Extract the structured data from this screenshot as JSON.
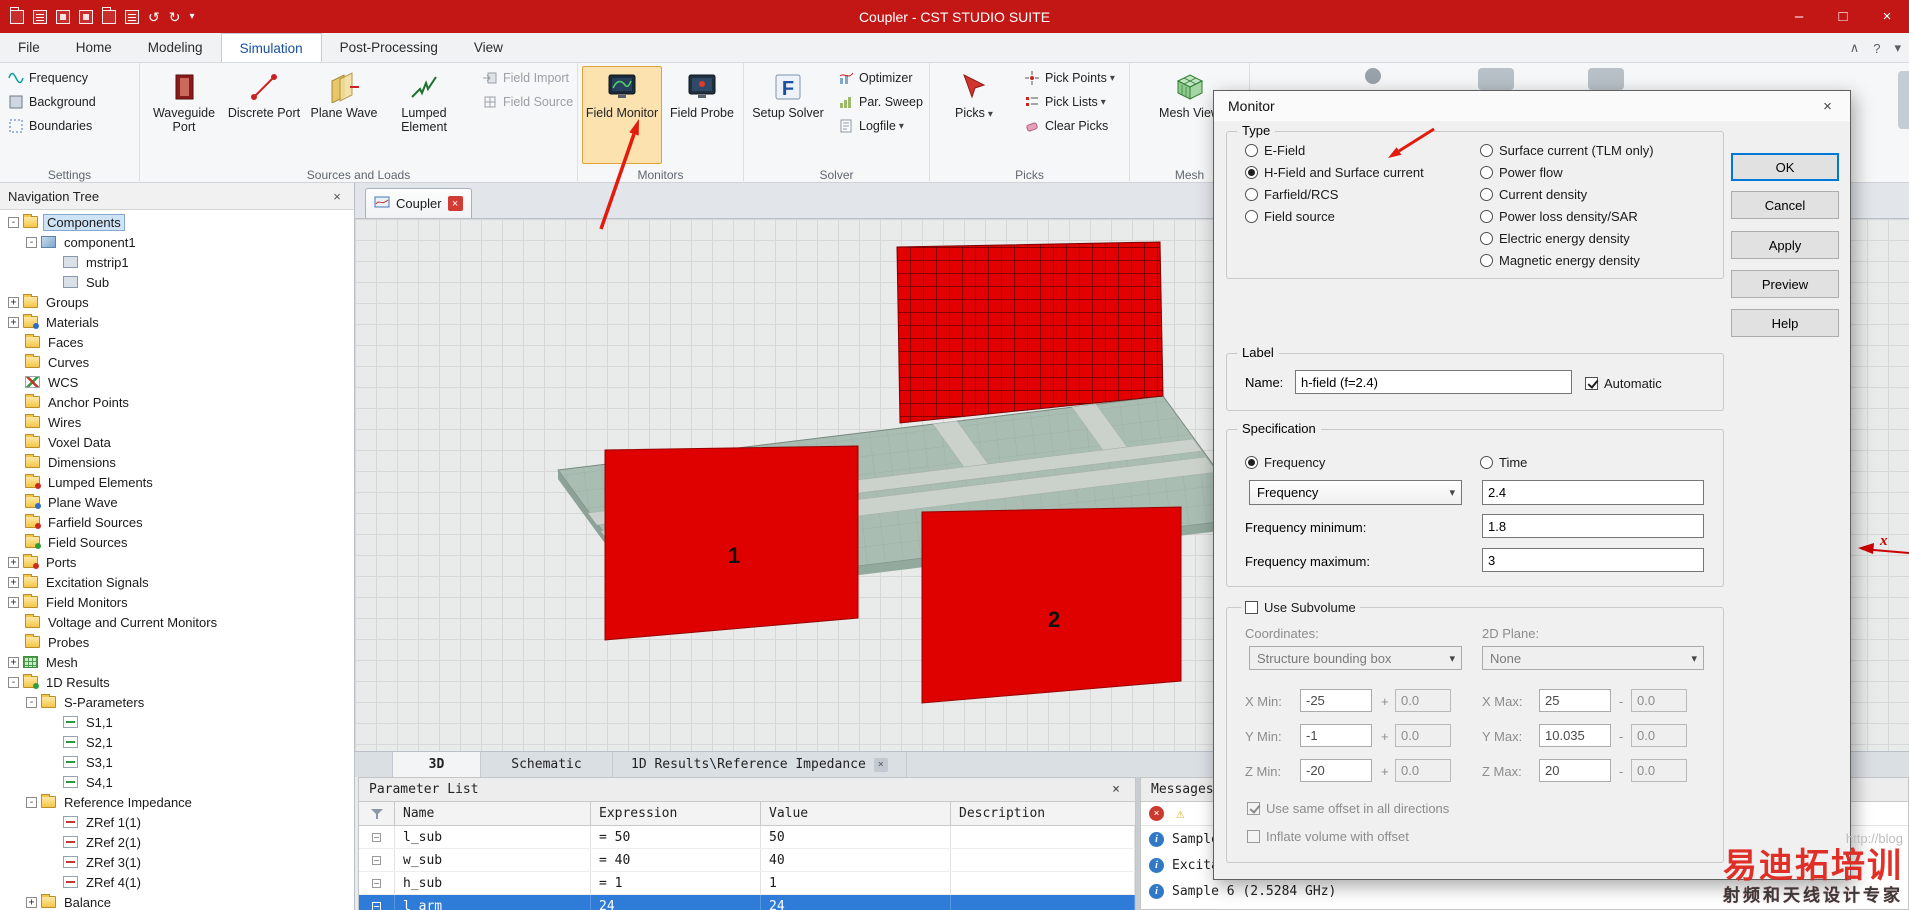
{
  "titlebar": {
    "title": "Coupler - CST STUDIO SUITE"
  },
  "menubar": {
    "tabs": [
      "File",
      "Home",
      "Modeling",
      "Simulation",
      "Post-Processing",
      "View"
    ]
  },
  "ribbon": {
    "settings": {
      "label": "Settings",
      "frequency": "Frequency",
      "background": "Background",
      "boundaries": "Boundaries"
    },
    "sources": {
      "label": "Sources and Loads",
      "waveguide": "Waveguide Port",
      "discrete": "Discrete Port",
      "plane": "Plane Wave",
      "lumped": "Lumped Element",
      "field_import": "Field Import",
      "field_source": "Field Source"
    },
    "monitors": {
      "label": "Monitors",
      "field_monitor": "Field Monitor",
      "field_probe": "Field Probe"
    },
    "solver": {
      "label": "Solver",
      "setup": "Setup Solver",
      "optimizer": "Optimizer",
      "par_sweep": "Par. Sweep",
      "logfile": "Logfile"
    },
    "picks": {
      "label": "Picks",
      "picks": "Picks",
      "pick_points": "Pick Points",
      "pick_lists": "Pick Lists",
      "clear_picks": "Clear Picks"
    },
    "mesh": {
      "label": "Mesh",
      "mesh_view": "Mesh View"
    }
  },
  "nav": {
    "title": "Navigation Tree",
    "items": [
      "Components",
      "component1",
      "mstrip1",
      "Sub",
      "Groups",
      "Materials",
      "Faces",
      "Curves",
      "WCS",
      "Anchor Points",
      "Wires",
      "Voxel Data",
      "Dimensions",
      "Lumped Elements",
      "Plane Wave",
      "Farfield Sources",
      "Field Sources",
      "Ports",
      "Excitation Signals",
      "Field Monitors",
      "Voltage and Current Monitors",
      "Probes",
      "Mesh",
      "1D Results",
      "S-Parameters",
      "S1,1",
      "S2,1",
      "S3,1",
      "S4,1",
      "Reference Impedance",
      "ZRef 1(1)",
      "ZRef 2(1)",
      "ZRef 3(1)",
      "ZRef 4(1)",
      "Balance"
    ]
  },
  "viewport": {
    "doc_tab": "Coupler",
    "view_tabs": [
      "3D",
      "Schematic",
      "1D Results\\Reference Impedance"
    ],
    "active_view_tab": "3D",
    "port_label_1": "1",
    "port_label_2": "2",
    "axis_x": "x"
  },
  "parameters": {
    "title": "Parameter List",
    "columns": [
      "Name",
      "Expression",
      "Value",
      "Description"
    ],
    "rows": [
      {
        "name": "l_sub",
        "expr": "= 50",
        "value": "50",
        "desc": ""
      },
      {
        "name": "w_sub",
        "expr": "= 40",
        "value": "40",
        "desc": ""
      },
      {
        "name": "h_sub",
        "expr": "= 1",
        "value": "1",
        "desc": ""
      },
      {
        "name": "l_arm",
        "expr": "24",
        "value": "24",
        "desc": ""
      }
    ]
  },
  "messages": {
    "title": "Messages",
    "items": [
      "Sample",
      "Excita",
      "Sample 6 (2.5284 GHz)"
    ]
  },
  "dialog": {
    "title": "Monitor",
    "type": {
      "label": "Type",
      "col1": [
        "E-Field",
        "H-Field and Surface current",
        "Farfield/RCS",
        "Field source"
      ],
      "col2": [
        "Surface current (TLM only)",
        "Power flow",
        "Current density",
        "Power loss density/SAR",
        "Electric energy density",
        "Magnetic energy density"
      ],
      "selected": "H-Field and Surface current"
    },
    "buttons": [
      "OK",
      "Cancel",
      "Apply",
      "Preview",
      "Help"
    ],
    "label_group": {
      "label": "Label",
      "name_label": "Name:",
      "name_value": "h-field (f=2.4)",
      "automatic": "Automatic"
    },
    "spec": {
      "label": "Specification",
      "frequency": "Frequency",
      "time": "Time",
      "combo": "Frequency",
      "value": "2.4",
      "min_label": "Frequency minimum:",
      "min": "1.8",
      "max_label": "Frequency maximum:",
      "max": "3"
    },
    "sub": {
      "use": "Use Subvolume",
      "coords_label": "Coordinates:",
      "coords": "Structure bounding box",
      "plane_label": "2D Plane:",
      "plane": "None",
      "xmin_l": "X Min:",
      "xmin": "-25",
      "xmin_o": "0.0",
      "xmax_l": "X Max:",
      "xmax": "25",
      "xmax_o": "0.0",
      "ymin_l": "Y Min:",
      "ymin": "-1",
      "ymin_o": "0.0",
      "ymax_l": "Y Max:",
      "ymax": "10.035",
      "ymax_o": "0.0",
      "zmin_l": "Z Min:",
      "zmin": "-20",
      "zmin_o": "0.0",
      "zmax_l": "Z Max:",
      "zmax": "20",
      "zmax_o": "0.0",
      "plus": "+",
      "minus": "-",
      "same_offset": "Use same offset in all directions",
      "inflate": "Inflate volume with offset"
    }
  },
  "watermark": {
    "url": "http://blog",
    "brand": "易迪拓培训",
    "tagline": "射频和天线设计专家"
  },
  "icons": {
    "close": "×",
    "minimize": "–",
    "maximize": "□",
    "caret": "▾",
    "collapse": "∧",
    "help": "?",
    "info": "i",
    "warning": "⚠",
    "plus": "+",
    "minus": "-",
    "undo": "↺",
    "redo": "↻"
  },
  "colors": {
    "titlebar_red": "#C21715",
    "annotation_red": "#E31B0C",
    "patch_red": "#DF0000",
    "selection_blue": "#2F7CD8",
    "substrate_green": "#A9BDB2"
  }
}
